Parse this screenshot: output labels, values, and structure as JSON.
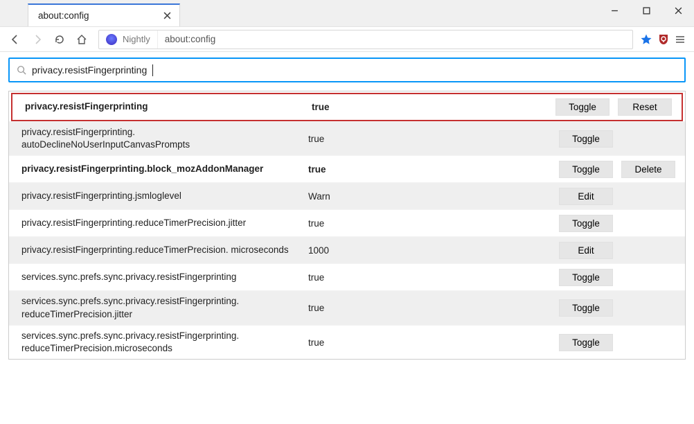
{
  "tab": {
    "title": "about:config"
  },
  "toolbar": {
    "identity_label": "Nightly",
    "address": "about:config"
  },
  "search": {
    "value": "privacy.resistFingerprinting"
  },
  "labels": {
    "toggle": "Toggle",
    "edit": "Edit",
    "reset": "Reset",
    "delete": "Delete"
  },
  "prefs": [
    {
      "name": "privacy.resistFingerprinting",
      "value": "true",
      "bold": true,
      "highlight": true,
      "action1": "toggle",
      "action2": "reset"
    },
    {
      "name": "privacy.resistFingerprinting. autoDeclineNoUserInputCanvasPrompts",
      "value": "true",
      "shade": true,
      "action1": "toggle"
    },
    {
      "name": "privacy.resistFingerprinting.block_mozAddonManager",
      "value": "true",
      "bold": true,
      "action1": "toggle",
      "action2": "delete"
    },
    {
      "name": "privacy.resistFingerprinting.jsmloglevel",
      "value": "Warn",
      "shade": true,
      "action1": "edit"
    },
    {
      "name": "privacy.resistFingerprinting.reduceTimerPrecision.jitter",
      "value": "true",
      "action1": "toggle"
    },
    {
      "name": "privacy.resistFingerprinting.reduceTimerPrecision. microseconds",
      "value": "1000",
      "shade": true,
      "action1": "edit"
    },
    {
      "name": "services.sync.prefs.sync.privacy.resistFingerprinting",
      "value": "true",
      "action1": "toggle"
    },
    {
      "name": "services.sync.prefs.sync.privacy.resistFingerprinting. reduceTimerPrecision.jitter",
      "value": "true",
      "shade": true,
      "action1": "toggle"
    },
    {
      "name": "services.sync.prefs.sync.privacy.resistFingerprinting. reduceTimerPrecision.microseconds",
      "value": "true",
      "action1": "toggle"
    }
  ]
}
